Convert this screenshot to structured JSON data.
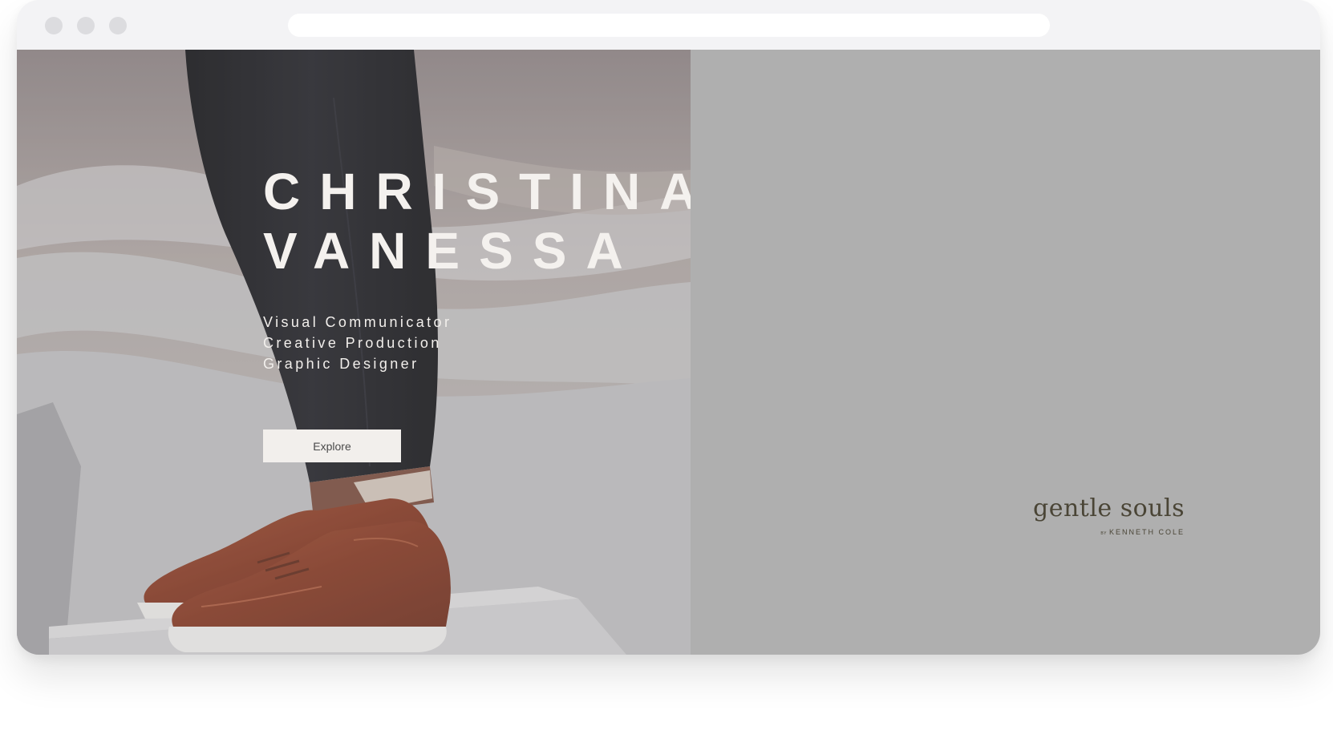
{
  "browser": {
    "window_buttons": [
      "close",
      "minimize",
      "maximize"
    ],
    "url": ""
  },
  "hero": {
    "name_line1": "CHRISTINA",
    "name_line2": "VANESSA",
    "roles": [
      "Visual Communicator",
      "Creative Production",
      "Graphic Designer"
    ],
    "cta_label": "Explore"
  },
  "brand_logo": {
    "main": "gentle souls",
    "by": "BY",
    "sub": "KENNETH COLE"
  },
  "colors": {
    "right_panel": "#afafaf",
    "headline_text": "#f4f1ee",
    "button_bg": "#f2efec",
    "shoe_leather": "#8a3b22",
    "trousers": "#15151a"
  }
}
